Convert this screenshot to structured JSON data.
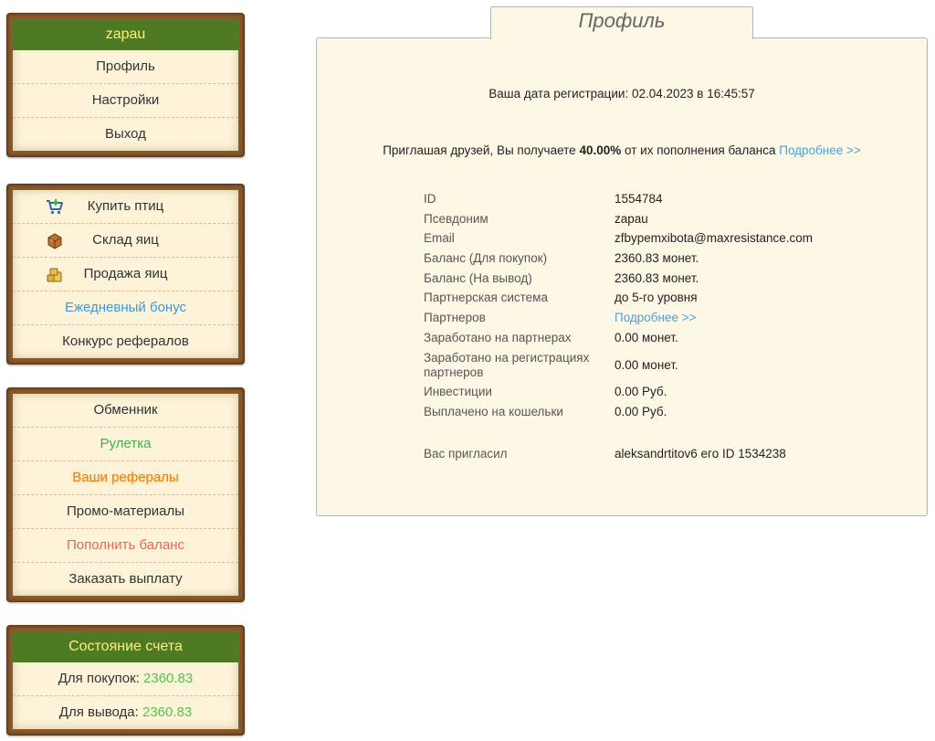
{
  "user_panel": {
    "username": "zapau",
    "items": [
      {
        "label": "Профиль"
      },
      {
        "label": "Настройки"
      },
      {
        "label": "Выход"
      }
    ]
  },
  "shop_panel": {
    "items": [
      {
        "label": "Купить птиц",
        "icon": "shopping-cart-icon"
      },
      {
        "label": "Склад яиц",
        "icon": "crate-icon"
      },
      {
        "label": "Продажа яиц",
        "icon": "coins-icon"
      },
      {
        "label": "Ежедневный бонус",
        "color": "#3a9ad9"
      },
      {
        "label": "Конкурс рефералов"
      }
    ]
  },
  "misc_panel": {
    "items": [
      {
        "label": "Обменник"
      },
      {
        "label": "Рулетка",
        "color": "#3fb24a"
      },
      {
        "label": "Ваши рефералы",
        "color": "#f07a10"
      },
      {
        "label": "Промо-материалы"
      },
      {
        "label": "Пополнить баланс",
        "color": "#e26a5a"
      },
      {
        "label": "Заказать выплату"
      }
    ]
  },
  "account_panel": {
    "title": "Состояние счета",
    "purchases_label": "Для покупок:",
    "purchases_value": "2360.83",
    "withdraw_label": "Для вывода:",
    "withdraw_value": "2360.83"
  },
  "profile": {
    "tab_title": "Профиль",
    "registration_text": "Ваша дата регистрации: 02.04.2023 в 16:45:57",
    "referral_prefix": "Приглашая друзей, Вы получаете",
    "referral_percent": "40.00%",
    "referral_suffix": "от их пополнения баланса",
    "referral_link": "Подробнее >>",
    "fields": {
      "id_label": "ID",
      "id_value": "1554784",
      "nick_label": "Псевдоним",
      "nick_value": "zapau",
      "email_label": "Email",
      "email_value": "zfbypemxibota@maxresistance.com",
      "balance_buy_label": "Баланс (Для покупок)",
      "balance_buy_value": "2360.83 монет.",
      "balance_out_label": "Баланс (На вывод)",
      "balance_out_value": "2360.83 монет.",
      "partner_system_label": "Партнерская система",
      "partner_system_value": "до 5-го уровня",
      "partners_label": "Партнеров",
      "partners_link": "Подробнее >>",
      "earned_partners_label": "Заработано на партнерах",
      "earned_partners_value": "0.00 монет.",
      "earned_reg_label": "Заработано на регистрациях партнеров",
      "earned_reg_value": "0.00 монет.",
      "investments_label": "Инвестиции",
      "investments_value": "0.00 Руб.",
      "paid_label": "Выплачено на кошельки",
      "paid_value": "0.00 Руб.",
      "invited_label": "Вас пригласил",
      "invited_value": "aleksandrtitov6 его ID 1534238"
    }
  },
  "colors": {
    "panel_head_bg": "#4e7a23",
    "panel_head_text": "#ffef7a",
    "wood_frame": "#8a5a2b",
    "panel_bg": "#fcf3d9",
    "link_blue": "#4a9fe0",
    "value_green": "#56c24c"
  }
}
